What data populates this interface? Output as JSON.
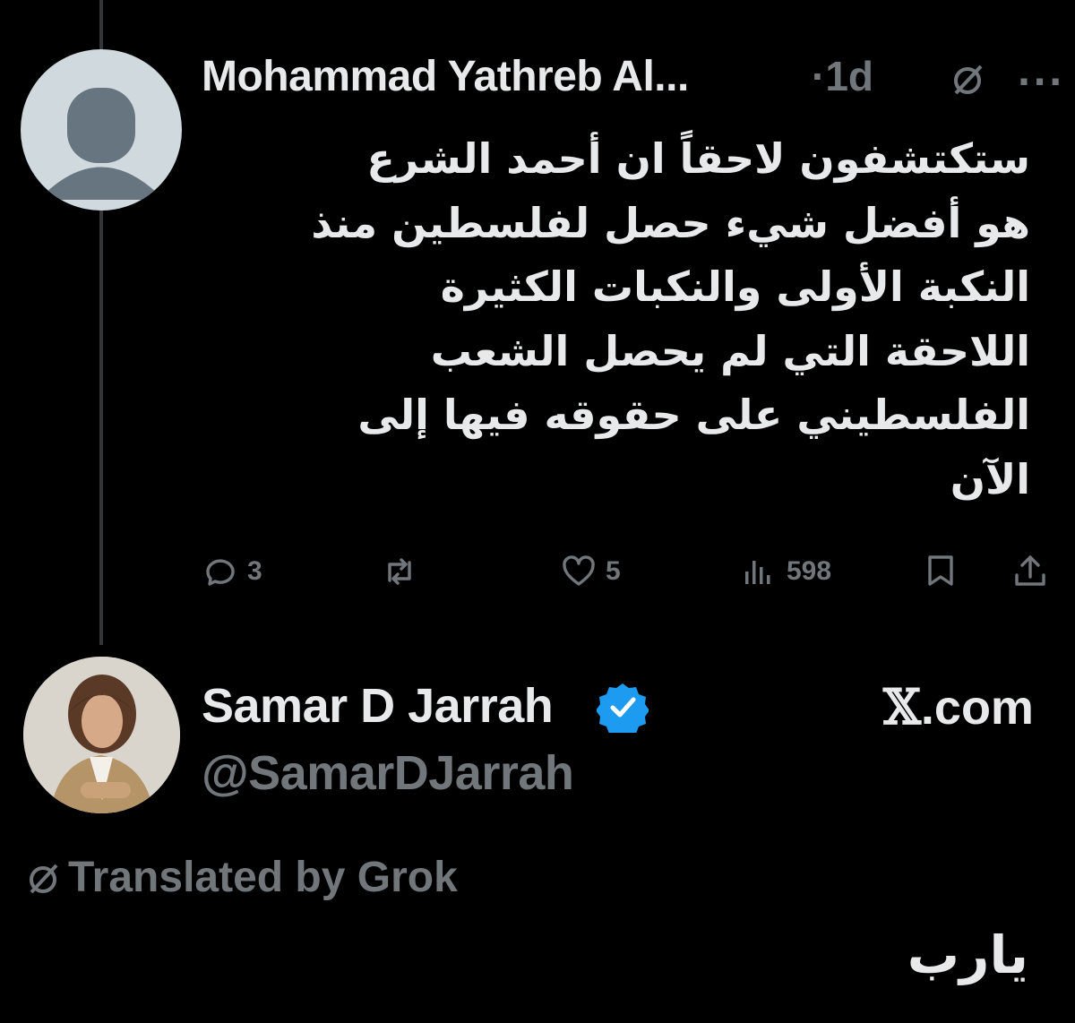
{
  "tweet": {
    "author_name": "Mohammad Yathreb Al...",
    "time": "·1d",
    "text_lines": [
      "ستكتشفون لاحقاً ان أحمد الشرع",
      "هو أفضل شيء حصل لفلسطين منذ",
      "النكبة الأولى والنكبات الكثيرة",
      "اللاحقة التي لم يحصل الشعب",
      "الفلسطيني على حقوقه فيها إلى",
      "الآن"
    ],
    "actions": {
      "replies": "3",
      "reposts": "",
      "likes": "5",
      "views": "598"
    }
  },
  "reply": {
    "author_name": "Samar D Jarrah",
    "handle": "@SamarDJarrah",
    "source_logo": "𝕏",
    "source_domain": ".com",
    "translated_label": "Translated by Grok",
    "text": "يارب"
  },
  "icons": {
    "grok": "grok-icon",
    "more": "more-icon",
    "reply": "reply-icon",
    "repost": "repost-icon",
    "like": "heart-icon",
    "views": "views-icon",
    "bookmark": "bookmark-icon",
    "share": "share-icon",
    "verified": "verified-badge-icon"
  },
  "colors": {
    "background": "#000000",
    "text": "#e7e9ea",
    "muted": "#71767b",
    "verified": "#1d9bf0"
  }
}
